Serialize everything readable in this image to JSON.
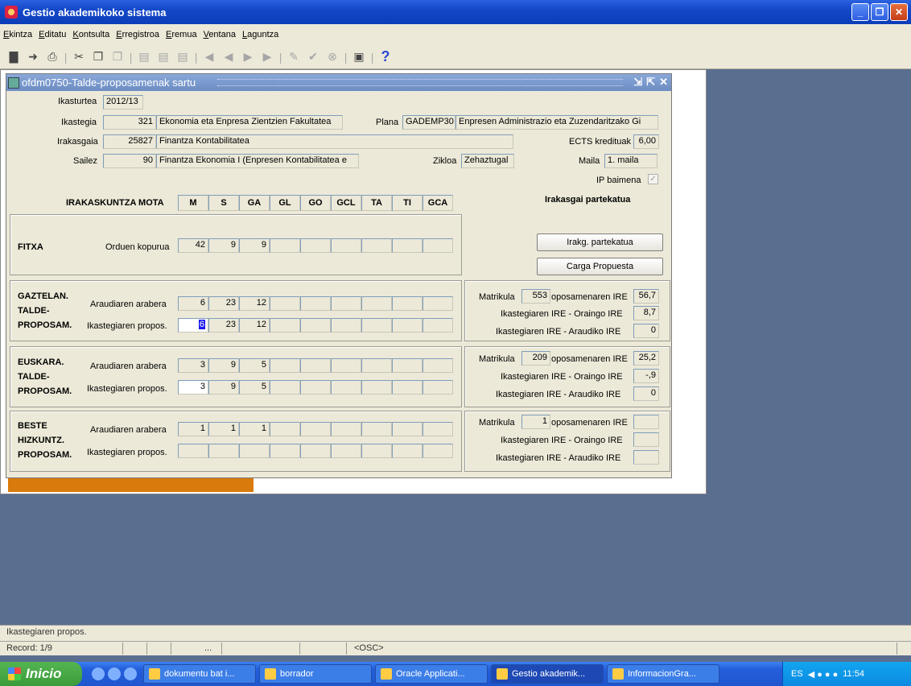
{
  "window": {
    "title": "Gestio akademikoko sistema"
  },
  "menu": [
    "Ekintza",
    "Editatu",
    "Kontsulta",
    "Erregistroa",
    "Eremua",
    "Ventana",
    "Laguntza"
  ],
  "form": {
    "title": "ofdm0750-Talde-proposamenak sartu",
    "ikasturtea_label": "Ikasturtea",
    "ikasturtea": "2012/13",
    "ikastegia_label": "Ikastegia",
    "ikastegia_code": "321",
    "ikastegia_name": "Ekonomia eta Enpresa Zientzien Fakultatea",
    "plana_label": "Plana",
    "plana_code": "GADEMP30",
    "plana_name": "Enpresen Administrazio eta Zuzendaritzako Gi",
    "irakasgaia_label": "Irakasgaia",
    "irakasgaia_code": "25827",
    "irakasgaia_name": "Finantza Kontabilitatea",
    "ects_label": "ECTS kredituak",
    "ects": "6,00",
    "saila_label": "Sailez",
    "saila_code": "90",
    "saila_name": "Finantza Ekonomia I (Enpresen Kontabilitatea e",
    "zikloa_label": "Zikloa",
    "zikloa": "Zehaztugal",
    "maila_label": "Maila",
    "maila": "1. maila",
    "ip_label": "IP baimena",
    "mota_label": "IRAKASKUNTZA MOTA",
    "headers": [
      "M",
      "S",
      "GA",
      "GL",
      "GO",
      "GCL",
      "TA",
      "TI",
      "GCA"
    ],
    "partekatua_label": "Irakasgai partekatua",
    "btn_partekatua": "Irakg. partekatua",
    "btn_carga": "Carga Propuesta"
  },
  "fitxa": {
    "name": "FITXA",
    "row_label": "Orduen kopurua",
    "values": [
      "42",
      "9",
      "9"
    ]
  },
  "gaztelan": {
    "name1": "GAZTELAN.",
    "name2": "TALDE-",
    "name3": "PROPOSAM.",
    "row1_label": "Araudiaren arabera",
    "row1": [
      "6",
      "23",
      "12"
    ],
    "row2_label": "Ikastegiaren propos.",
    "row2": [
      "6",
      "23",
      "12"
    ],
    "matrikula_label": "Matrikula",
    "matrikula": "553",
    "ire1_label": "oposamenaren IRE",
    "ire1": "56,7",
    "ire2_label": "Ikastegiaren IRE - Oraingo IRE",
    "ire2": "8,7",
    "ire3_label": "Ikastegiaren IRE - Araudiko IRE",
    "ire3": "0"
  },
  "euskara": {
    "name1": "EUSKARA.",
    "name2": "TALDE-",
    "name3": "PROPOSAM.",
    "row1_label": "Araudiaren arabera",
    "row1": [
      "3",
      "9",
      "5"
    ],
    "row2_label": "Ikastegiaren propos.",
    "row2": [
      "3",
      "9",
      "5"
    ],
    "matrikula_label": "Matrikula",
    "matrikula": "209",
    "ire1_label": "oposamenaren IRE",
    "ire1": "25,2",
    "ire2_label": "Ikastegiaren IRE - Oraingo IRE",
    "ire2": "-,9",
    "ire3_label": "Ikastegiaren IRE - Araudiko IRE",
    "ire3": "0"
  },
  "beste": {
    "name1": "BESTE",
    "name2": "HIZKUNTZ.",
    "name3": "PROPOSAM.",
    "row1_label": "Araudiaren arabera",
    "row1": [
      "1",
      "1",
      "1"
    ],
    "row2_label": "Ikastegiaren propos.",
    "matrikula_label": "Matrikula",
    "matrikula": "1",
    "ire1_label": "oposamenaren IRE",
    "ire2_label": "Ikastegiaren IRE - Oraingo IRE",
    "ire3_label": "Ikastegiaren IRE - Araudiko IRE"
  },
  "status": {
    "message": "Ikastegiaren propos.",
    "record": "Record: 1/9",
    "dots": "...",
    "osc": "<OSC>"
  },
  "taskbar": {
    "start": "Inicio",
    "tasks": [
      "dokumentu bat i...",
      "borrador",
      "Oracle Applicati...",
      "Gestio akademik...",
      "InformacionGra..."
    ],
    "lang": "ES",
    "clock": "11:54"
  }
}
